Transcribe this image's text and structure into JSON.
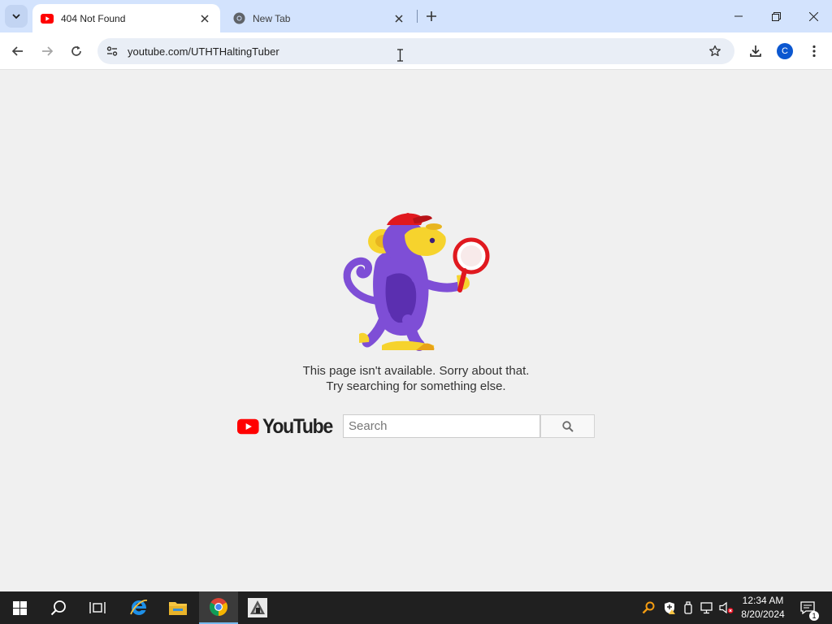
{
  "browser": {
    "tabs": [
      {
        "title": "404 Not Found",
        "active": true
      },
      {
        "title": "New Tab",
        "active": false
      }
    ],
    "url": "youtube.com/UTHTHaltingTuber",
    "profile_initial": "C"
  },
  "page": {
    "message_line1": "This page isn't available. Sorry about that.",
    "message_line2": "Try searching for something else.",
    "logo_text": "YouTube",
    "search_placeholder": "Search"
  },
  "taskbar": {
    "time": "12:34 AM",
    "date": "8/20/2024",
    "notification_count": "1"
  },
  "colors": {
    "tabstrip": "#d3e3fd",
    "youtube_red": "#ff0000",
    "monkey_purple": "#7e4ed6",
    "monkey_yellow": "#f6d32d",
    "cap_red": "#e0191f"
  }
}
